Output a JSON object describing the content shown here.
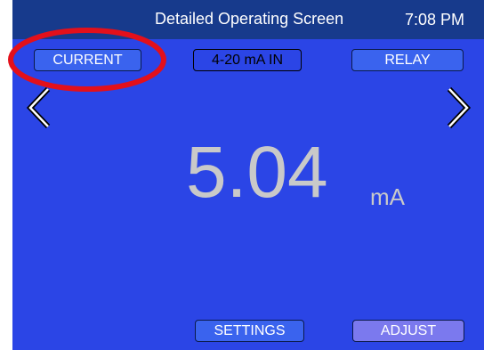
{
  "header": {
    "title": "Detailed Operating Screen",
    "time": "7:08 PM"
  },
  "tabs": {
    "current_label": "CURRENT",
    "ma_in_label": "4-20 mA IN",
    "relay_label": "RELAY"
  },
  "navigation": {
    "prev_icon": "chevron-left-icon",
    "next_icon": "chevron-right-icon"
  },
  "reading": {
    "value": "5.04",
    "unit": "mA"
  },
  "footer": {
    "settings_label": "SETTINGS",
    "adjust_label": "ADJUST"
  },
  "annotation": {
    "highlight_color": "#e3101b",
    "highlight_target": "CURRENT"
  },
  "colors": {
    "screen_bg": "#2b45e6",
    "title_bar_bg": "#173a8c",
    "button_bg": "#3a63ee",
    "adjust_bg": "#7b79ee",
    "reading_color": "#c9c9c9"
  }
}
